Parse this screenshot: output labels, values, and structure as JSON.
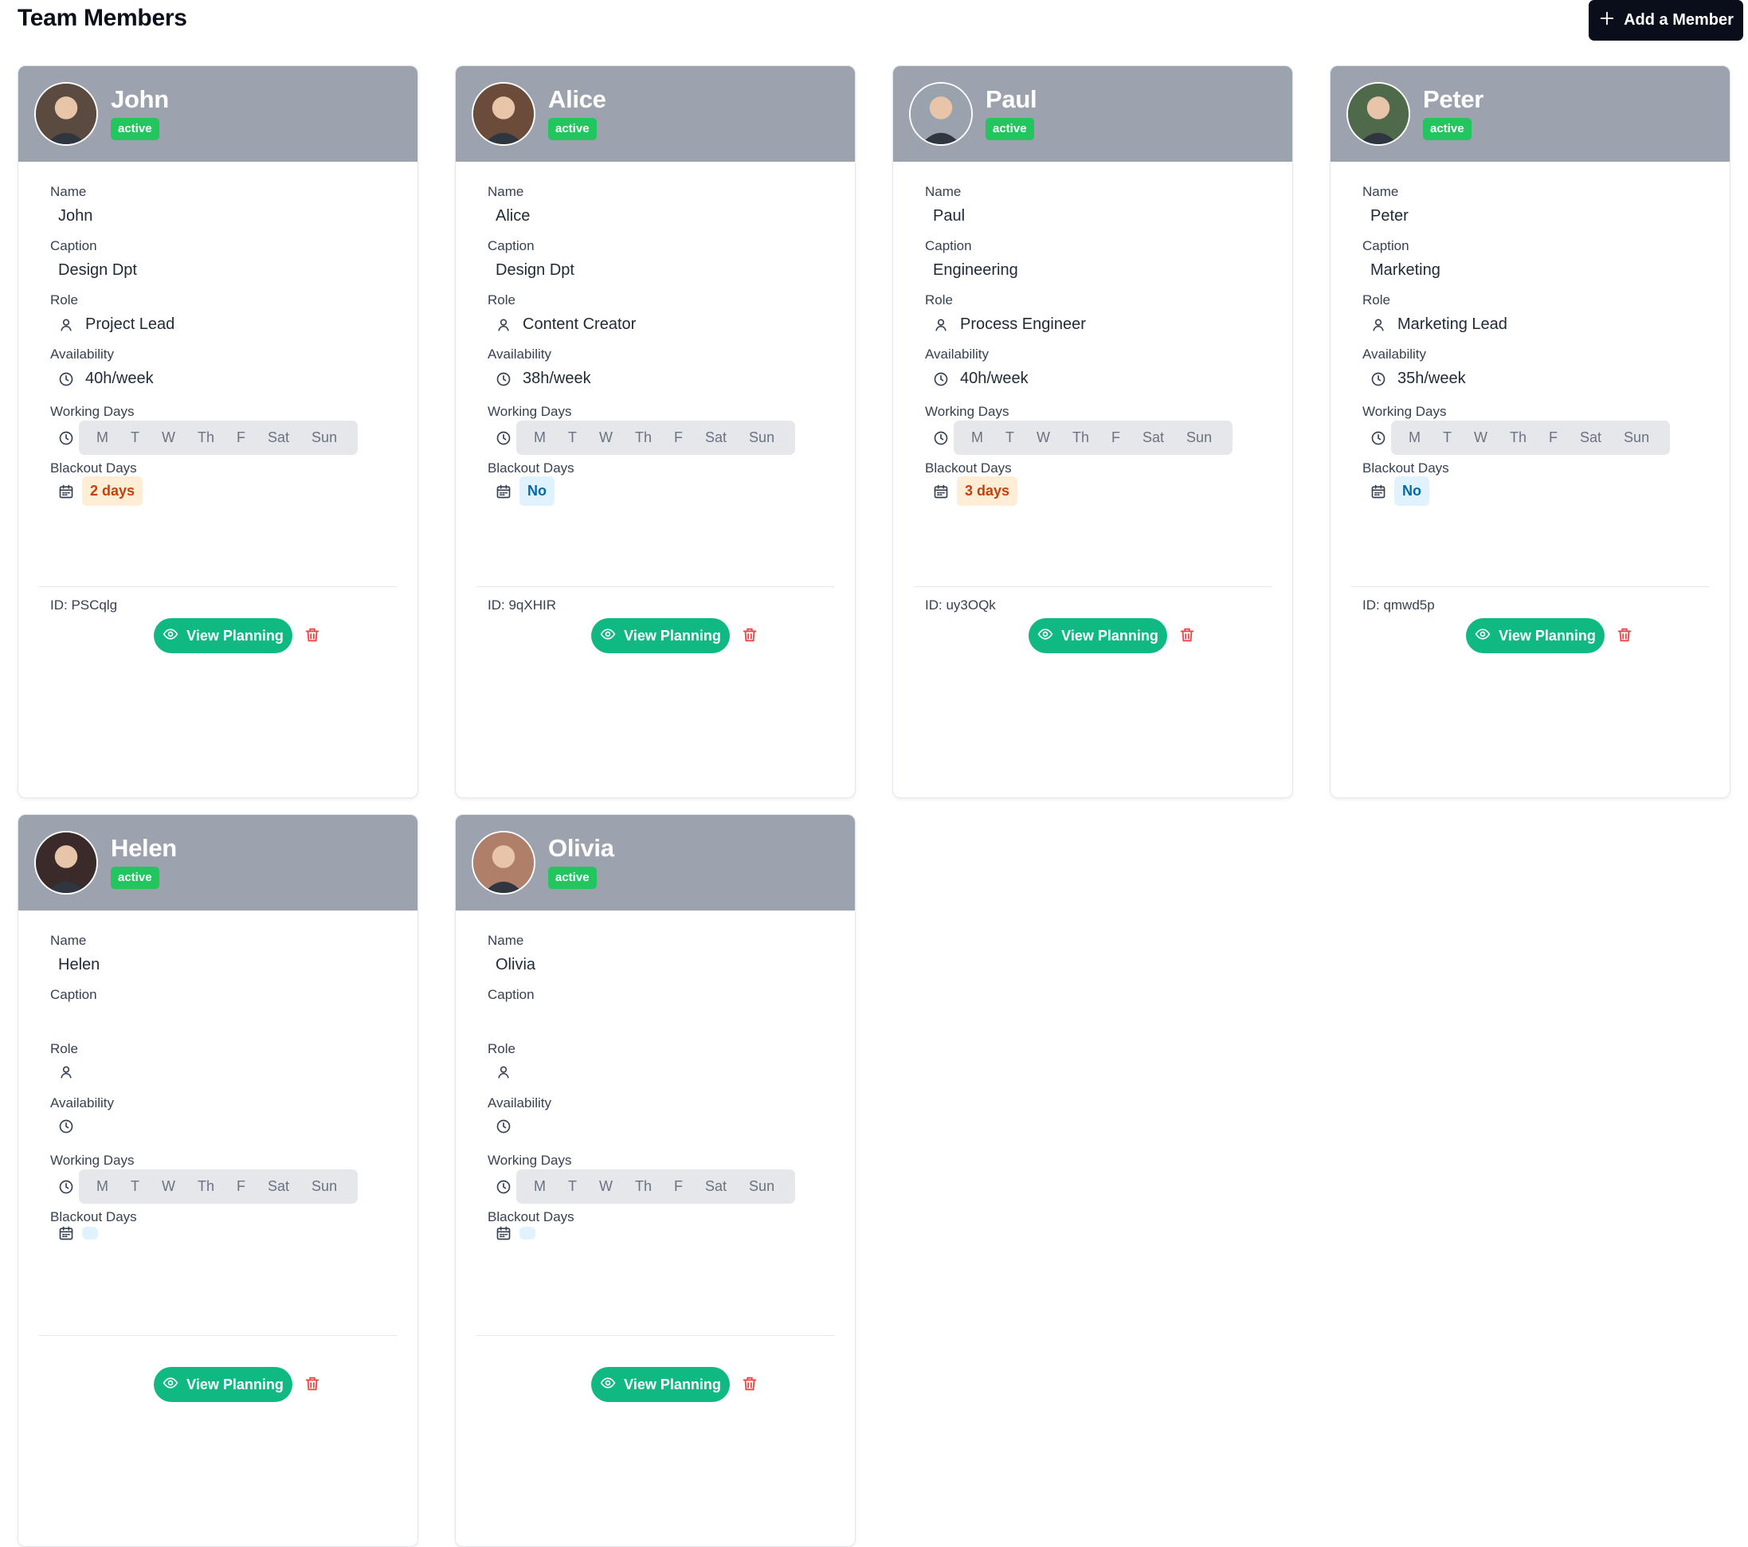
{
  "header": {
    "title": "Team Members",
    "add_button_label": "Add a Member"
  },
  "labels": {
    "name": "Name",
    "caption": "Caption",
    "role": "Role",
    "availability": "Availability",
    "working_days": "Working Days",
    "blackout_days": "Blackout Days",
    "view_planning": "View Planning"
  },
  "week_days": [
    "M",
    "T",
    "W",
    "Th",
    "F",
    "Sat",
    "Sun"
  ],
  "members": [
    {
      "name": "John",
      "status": "active",
      "caption": "Design Dpt",
      "role": "Project Lead",
      "availability": "40h/week",
      "selected_days": [
        "M"
      ],
      "blackout": "2 days",
      "blackout_kind": "warn",
      "id": "ID: PSCqlg",
      "avatar_color": "#5b4a3f"
    },
    {
      "name": "Alice",
      "status": "active",
      "caption": "Design Dpt",
      "role": "Content Creator",
      "availability": "38h/week",
      "selected_days": [
        "M"
      ],
      "blackout": "No",
      "blackout_kind": "none",
      "id": "ID: 9qXHIR",
      "avatar_color": "#6b4b3a"
    },
    {
      "name": "Paul",
      "status": "active",
      "caption": "Engineering",
      "role": "Process Engineer",
      "availability": "40h/week",
      "selected_days": [
        "M"
      ],
      "blackout": "3 days",
      "blackout_kind": "warn",
      "id": "ID: uy3OQk",
      "avatar_color": "#9aa3ad"
    },
    {
      "name": "Peter",
      "status": "active",
      "caption": "Marketing",
      "role": "Marketing Lead",
      "availability": "35h/week",
      "selected_days": [
        "M"
      ],
      "blackout": "No",
      "blackout_kind": "none",
      "id": "ID: qmwd5p",
      "avatar_color": "#4f6a4a"
    },
    {
      "name": "Helen",
      "status": "active",
      "caption": "",
      "role": "",
      "availability": "",
      "selected_days": [
        "M"
      ],
      "blackout": "",
      "blackout_kind": "none",
      "id": "",
      "avatar_color": "#3a2a2a"
    },
    {
      "name": "Olivia",
      "status": "active",
      "caption": "",
      "role": "",
      "availability": "",
      "selected_days": [
        "M"
      ],
      "blackout": "",
      "blackout_kind": "none",
      "id": "",
      "avatar_color": "#b07f6a"
    }
  ],
  "colors": {
    "header_bg": "#9ca3af",
    "status_active": "#22c55e",
    "view_button": "#10b981",
    "delete_icon": "#ef4444",
    "add_button": "#0a0e1a"
  }
}
